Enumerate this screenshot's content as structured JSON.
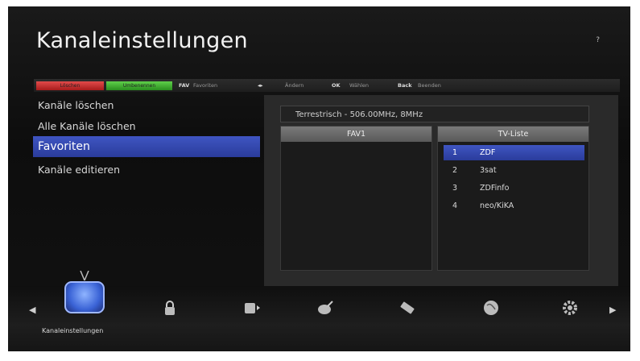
{
  "header": {
    "title": "Kanaleinstellungen",
    "help": "?"
  },
  "hints": {
    "red": "Löschen",
    "green": "Umbenennen",
    "fav_key": "FAV",
    "fav_text": "Favoriten",
    "arrows_key": "◂▸",
    "arrows_text": "Ändern",
    "ok_key": "OK",
    "ok_text": "Wählen",
    "back_key": "Back",
    "back_text": "Beenden"
  },
  "menu": {
    "items": [
      {
        "label": "Kanäle löschen"
      },
      {
        "label": "Alle Kanäle löschen"
      },
      {
        "label": "Favoriten",
        "selected": true
      },
      {
        "label": "Kanäle editieren"
      }
    ]
  },
  "info": "Terrestrisch - 506.00MHz, 8MHz",
  "fav_list": {
    "header": "FAV1"
  },
  "tv_list": {
    "header": "TV-Liste",
    "rows": [
      {
        "num": "1",
        "name": "ZDF",
        "selected": true
      },
      {
        "num": "2",
        "name": "3sat"
      },
      {
        "num": "3",
        "name": "ZDFinfo"
      },
      {
        "num": "4",
        "name": "neo/KiKA"
      }
    ]
  },
  "dock": {
    "label": "Kanaleinstellungen",
    "icons": [
      "tv-icon",
      "lock-icon",
      "media-icon",
      "satellite-icon",
      "usb-icon",
      "globe-icon",
      "gear-icon"
    ]
  },
  "colors": {
    "accent": "#3a4fbf",
    "red": "#c22a2a",
    "green": "#3caa2b"
  }
}
